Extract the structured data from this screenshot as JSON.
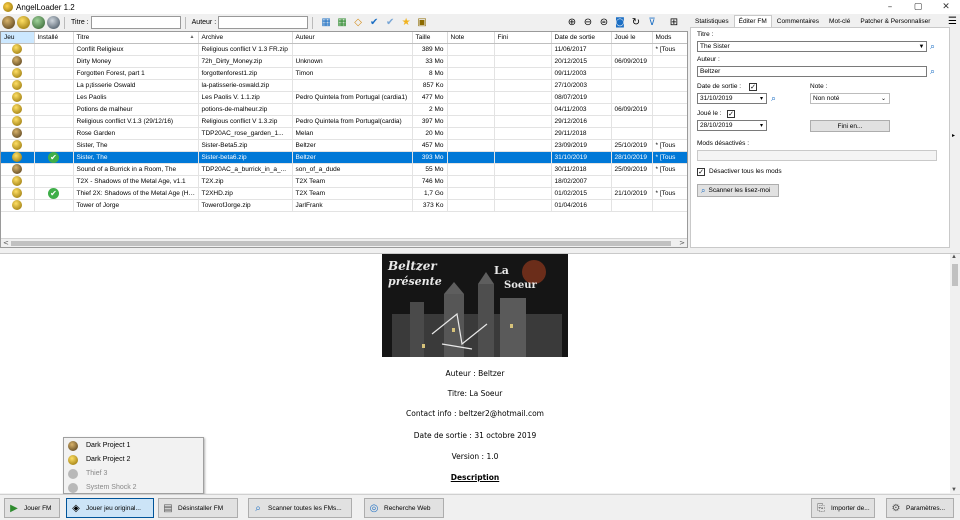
{
  "window": {
    "title": "AngelLoader 1.2",
    "controls": [
      "–",
      "▢",
      "✕"
    ]
  },
  "toolbar": {
    "title_label": "Titre :",
    "title_value": "",
    "author_label": "Auteur :",
    "author_value": ""
  },
  "grid": {
    "columns": [
      "Jeu",
      "Installé",
      "Titre",
      "Archive",
      "Auteur",
      "Taille",
      "Note",
      "Fini",
      "Date de sortie",
      "Joué le",
      "Mods"
    ],
    "sort_indicator": "▲",
    "rows": [
      {
        "game": "gold",
        "installed": false,
        "title": "Conflit Religieux",
        "archive": "Religious conflict V 1.3 FR.zip",
        "author": "",
        "size": "389 Mo",
        "note": "",
        "finished": "",
        "release": "11/06/2017",
        "played": "",
        "mods": "* [Tous"
      },
      {
        "game": "dark",
        "installed": false,
        "title": "Dirty Money",
        "archive": "72h_Dirty_Money.zip",
        "author": "Unknown",
        "size": "33 Mo",
        "note": "",
        "finished": "",
        "release": "20/12/2015",
        "played": "06/09/2019",
        "mods": ""
      },
      {
        "game": "gold",
        "installed": false,
        "title": "Forgotten Forest, part 1",
        "archive": "forgottenforest1.zip",
        "author": "Timon",
        "size": "8 Mo",
        "note": "",
        "finished": "",
        "release": "09/11/2003",
        "played": "",
        "mods": ""
      },
      {
        "game": "gold",
        "installed": false,
        "title": "La p¡tisserie Oswald",
        "archive": "la-patisserie-oswald.zip",
        "author": "",
        "size": "857 Ko",
        "note": "",
        "finished": "",
        "release": "27/10/2003",
        "played": "",
        "mods": ""
      },
      {
        "game": "gold",
        "installed": false,
        "title": "Les Paolis",
        "archive": "Les Paolis V. 1.1.zip",
        "author": "Pedro Quintela from Portugal (cardia1)",
        "size": "477 Mo",
        "note": "",
        "finished": "",
        "release": "08/07/2019",
        "played": "",
        "mods": ""
      },
      {
        "game": "gold",
        "installed": false,
        "title": "Potions de malheur",
        "archive": "potions-de-malheur.zip",
        "author": "",
        "size": "2 Mo",
        "note": "",
        "finished": "",
        "release": "04/11/2003",
        "played": "06/09/2019",
        "mods": ""
      },
      {
        "game": "gold",
        "installed": false,
        "title": "Religious conflict V.1.3 (29/12/16)",
        "archive": "Religious conflict V 1.3.zip",
        "author": "Pedro Quintela from Portugal(cardia)",
        "size": "397 Mo",
        "note": "",
        "finished": "",
        "release": "29/12/2016",
        "played": "",
        "mods": ""
      },
      {
        "game": "dark",
        "installed": false,
        "title": "Rose Garden",
        "archive": "TDP20AC_rose_garden_1...",
        "author": "Melan",
        "size": "20 Mo",
        "note": "",
        "finished": "",
        "release": "29/11/2018",
        "played": "",
        "mods": ""
      },
      {
        "game": "gold",
        "installed": false,
        "title": "Sister, The",
        "archive": "Sister-Beta5.zip",
        "author": "Beltzer",
        "size": "457 Mo",
        "note": "",
        "finished": "",
        "release": "23/09/2019",
        "played": "25/10/2019",
        "mods": "* [Tous"
      },
      {
        "game": "gold",
        "installed": true,
        "title": "Sister, The",
        "archive": "Sister-beta6.zip",
        "author": "Beltzer",
        "size": "393 Mo",
        "note": "",
        "finished": "",
        "release": "31/10/2019",
        "played": "28/10/2019",
        "mods": "* [Tous",
        "selected": true
      },
      {
        "game": "dark",
        "installed": false,
        "title": "Sound of a Burrick in a Room, The",
        "archive": "TDP20AC_a_burrick_in_a_...",
        "author": "son_of_a_dude",
        "size": "55 Mo",
        "note": "",
        "finished": "",
        "release": "30/11/2018",
        "played": "25/09/2019",
        "mods": "* [Tous"
      },
      {
        "game": "gold",
        "installed": false,
        "title": "T2X - Shadows of the Metal Age, v1.1",
        "archive": "T2X.zip",
        "author": "T2X Team",
        "size": "746 Mo",
        "note": "",
        "finished": "",
        "release": "18/02/2007",
        "played": "",
        "mods": ""
      },
      {
        "game": "gold",
        "installed": true,
        "title": "Thief 2X: Shadows of the Metal Age (HD ...",
        "archive": "T2XHD.zip",
        "author": "T2X Team",
        "size": "1,7 Go",
        "note": "",
        "finished": "",
        "release": "01/02/2015",
        "played": "21/10/2019",
        "mods": "* [Tous"
      },
      {
        "game": "gold",
        "installed": false,
        "title": "Tower of Jorge",
        "archive": "TowerofJorge.zip",
        "author": "JarlFrank",
        "size": "373 Ko",
        "note": "",
        "finished": "",
        "release": "01/04/2016",
        "played": "",
        "mods": ""
      }
    ]
  },
  "right_panel": {
    "tabs": [
      "Statistiques",
      "Éditer FM",
      "Commentaires",
      "Mot-clé",
      "Patcher & Personnaliser"
    ],
    "active_tab": "Éditer FM",
    "title_label": "Titre :",
    "title_value": "The Sister",
    "author_label": "Auteur :",
    "author_value": "Beltzer",
    "release_label": "Date de sortie :",
    "release_checked": true,
    "release_value": "31/10/2019",
    "played_label": "Joué le :",
    "played_checked": true,
    "played_value": "28/10/2019",
    "note_label": "Note :",
    "note_value": "Non noté",
    "finished_button": "Fini en...",
    "mods_label": "Mods désactivés :",
    "mods_value": "",
    "disable_all_mods_label": "Désactiver tous les mods",
    "disable_all_mods_checked": true,
    "scan_readme_button": "Scanner les lisez-moi"
  },
  "readme": {
    "banner_line1": "Beltzer",
    "banner_line2": "présente",
    "banner_title1": "La",
    "banner_title2": "Soeur",
    "lines": [
      "Auteur : Beltzer",
      "Titre: La Soeur",
      "Contact info : beltzer2@hotmail.com",
      "Date de sortie : 31 octobre 2019",
      "Version : 1.0"
    ],
    "description_heading": "Description"
  },
  "game_menu": {
    "items": [
      {
        "label": "Dark Project 1",
        "enabled": true,
        "icon": "dark"
      },
      {
        "label": "Dark Project 2",
        "enabled": true,
        "icon": "gold"
      },
      {
        "label": "Thief 3",
        "enabled": false,
        "icon": "dis"
      },
      {
        "label": "System Shock 2",
        "enabled": false,
        "icon": "dis"
      }
    ]
  },
  "bottom": {
    "play_fm": "Jouer FM",
    "play_original": "Jouer jeu original...",
    "uninstall_fm": "Désinstaller FM",
    "scan_all": "Scanner toutes les FMs...",
    "web_search": "Recherche Web",
    "import_from": "Importer de...",
    "settings": "Paramètres..."
  },
  "colors": {
    "selection": "#0078d7",
    "accent_blue": "#1c6fc4",
    "installed_green": "#3fae49"
  }
}
